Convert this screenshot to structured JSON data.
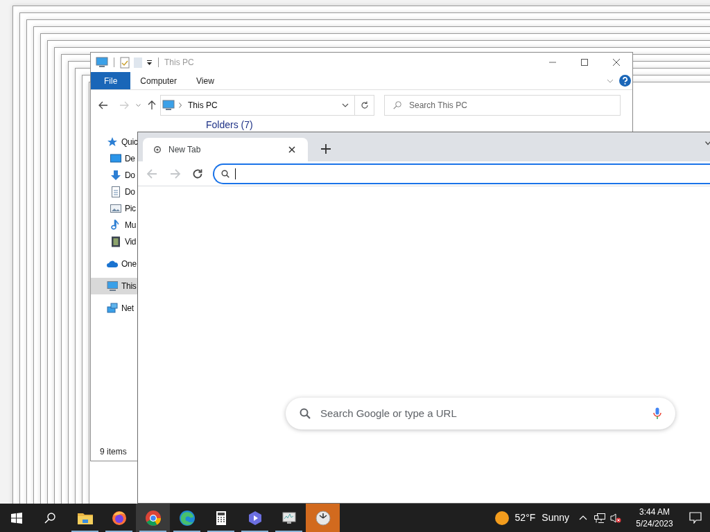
{
  "explorer": {
    "title": "This PC",
    "ribbon_tabs": [
      {
        "label": "File",
        "selected": true
      },
      {
        "label": "Computer",
        "selected": false
      },
      {
        "label": "View",
        "selected": false
      }
    ],
    "address": "This PC",
    "search": {
      "placeholder": "Search This PC"
    },
    "group_header": "Folders (7)",
    "nav": [
      {
        "label": "Quic",
        "kind": "star",
        "selected": false,
        "children": [
          {
            "label": "De",
            "kind": "desktop",
            "selected": false
          },
          {
            "label": "Do",
            "kind": "download",
            "selected": false
          },
          {
            "label": "Do",
            "kind": "document",
            "selected": false
          },
          {
            "label": "Pic",
            "kind": "pictures",
            "selected": false
          },
          {
            "label": "Mu",
            "kind": "music",
            "selected": false
          },
          {
            "label": "Vid",
            "kind": "video",
            "selected": false
          }
        ]
      },
      {
        "label": "One",
        "kind": "cloud",
        "selected": false
      },
      {
        "label": "This",
        "kind": "pc",
        "selected": true
      },
      {
        "label": "Net",
        "kind": "network",
        "selected": false
      }
    ],
    "status": "9 items"
  },
  "browser": {
    "tabs": [
      {
        "label": "New Tab",
        "selected": true
      }
    ],
    "search_box": {
      "placeholder": "Search Google or type a URL"
    }
  },
  "taskbar": {
    "apps": [
      {
        "kind": "explorer",
        "selected": false,
        "flashing": false
      },
      {
        "kind": "firefox",
        "selected": false,
        "flashing": false
      },
      {
        "kind": "chrome",
        "selected": true,
        "flashing": false
      },
      {
        "kind": "edge",
        "selected": false,
        "flashing": false
      },
      {
        "kind": "calculator",
        "selected": false,
        "flashing": false
      },
      {
        "kind": "player",
        "selected": false,
        "flashing": false
      },
      {
        "kind": "monitor",
        "selected": false,
        "flashing": false
      },
      {
        "kind": "clock",
        "selected": false,
        "flashing": true
      }
    ],
    "weather": {
      "temperature": "52°F",
      "condition": "Sunny"
    },
    "time": "3:44 AM",
    "date": "5/24/2023"
  }
}
